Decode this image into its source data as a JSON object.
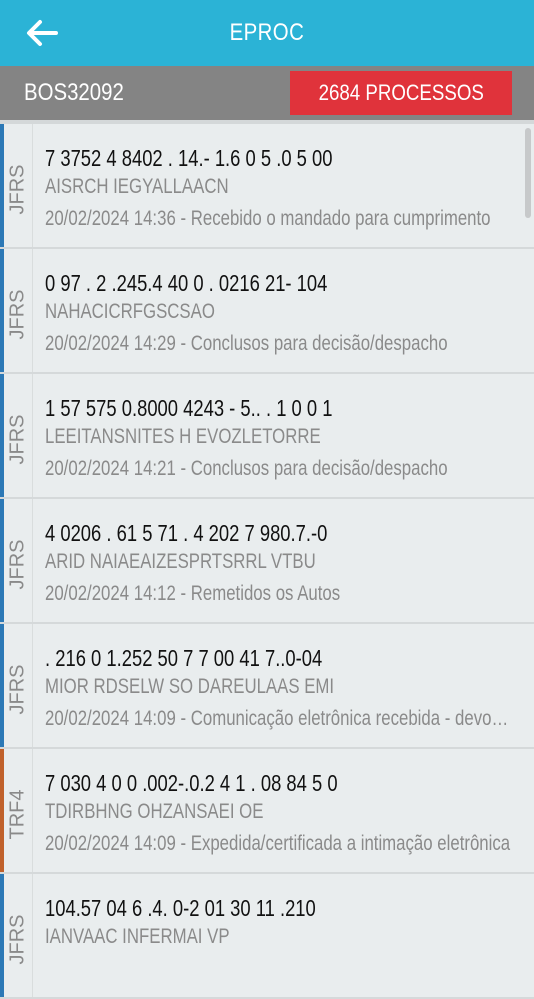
{
  "header": {
    "title": "EPROC",
    "back_icon": "arrow-left-icon"
  },
  "subheader": {
    "user_code": "BOS32092",
    "count_label": "2684 PROCESSOS",
    "badge_color": "#e0333b"
  },
  "colors": {
    "topbar": "#2bb3d6",
    "stripe_jfrs": "#2c79b6",
    "stripe_trf4": "#c0612b"
  },
  "processes": [
    {
      "court": "JFRS",
      "number": "7 3752 4 8402 . 14.- 1.6 0 5 .0 5 00",
      "parties": "AISRCH IEGYALLAACN",
      "timestamp": "20/02/2024 14:36",
      "event": "Recebido o mandado para cumprimento"
    },
    {
      "court": "JFRS",
      "number": "0 97 . 2 .245.4 40 0 . 0216 21- 104",
      "parties": "NAHACICRFGSCSAO",
      "timestamp": "20/02/2024 14:29",
      "event": "Conclusos para decisão/despacho"
    },
    {
      "court": "JFRS",
      "number": "1 57 575 0.8000 4243 - 5.. . 1 0 0 1",
      "parties": "LEEITANSNITES H EVOZLETORRE",
      "timestamp": "20/02/2024 14:21",
      "event": "Conclusos para decisão/despacho"
    },
    {
      "court": "JFRS",
      "number": "4 0206 . 61 5 71 . 4 202 7 980.7.-0",
      "parties": "ARID NAIAEAIZESPRTSRRL VTBU",
      "timestamp": "20/02/2024 14:12",
      "event": "Remetidos os Autos"
    },
    {
      "court": "JFRS",
      "number": ". 216 0 1.252 50 7 7 00 41 7..0-04",
      "parties": "MIOR RDSELW SO DAREULAAS EMI",
      "timestamp": "20/02/2024 14:09",
      "event": "Comunicação eletrônica recebida - devolvida"
    },
    {
      "court": "TRF4",
      "number": "7 030 4 0 0 .002-.0.2 4 1 . 08 84 5 0",
      "parties": "TDIRBHNG OHZANSAEI OE",
      "timestamp": "20/02/2024 14:09",
      "event": "Expedida/certificada a intimação eletrônica"
    },
    {
      "court": "JFRS",
      "number": "104.57 04 6 .4. 0-2 01 30 11 .210",
      "parties": "IANVAAC INFERMAI VP",
      "timestamp": "",
      "event": ""
    }
  ]
}
